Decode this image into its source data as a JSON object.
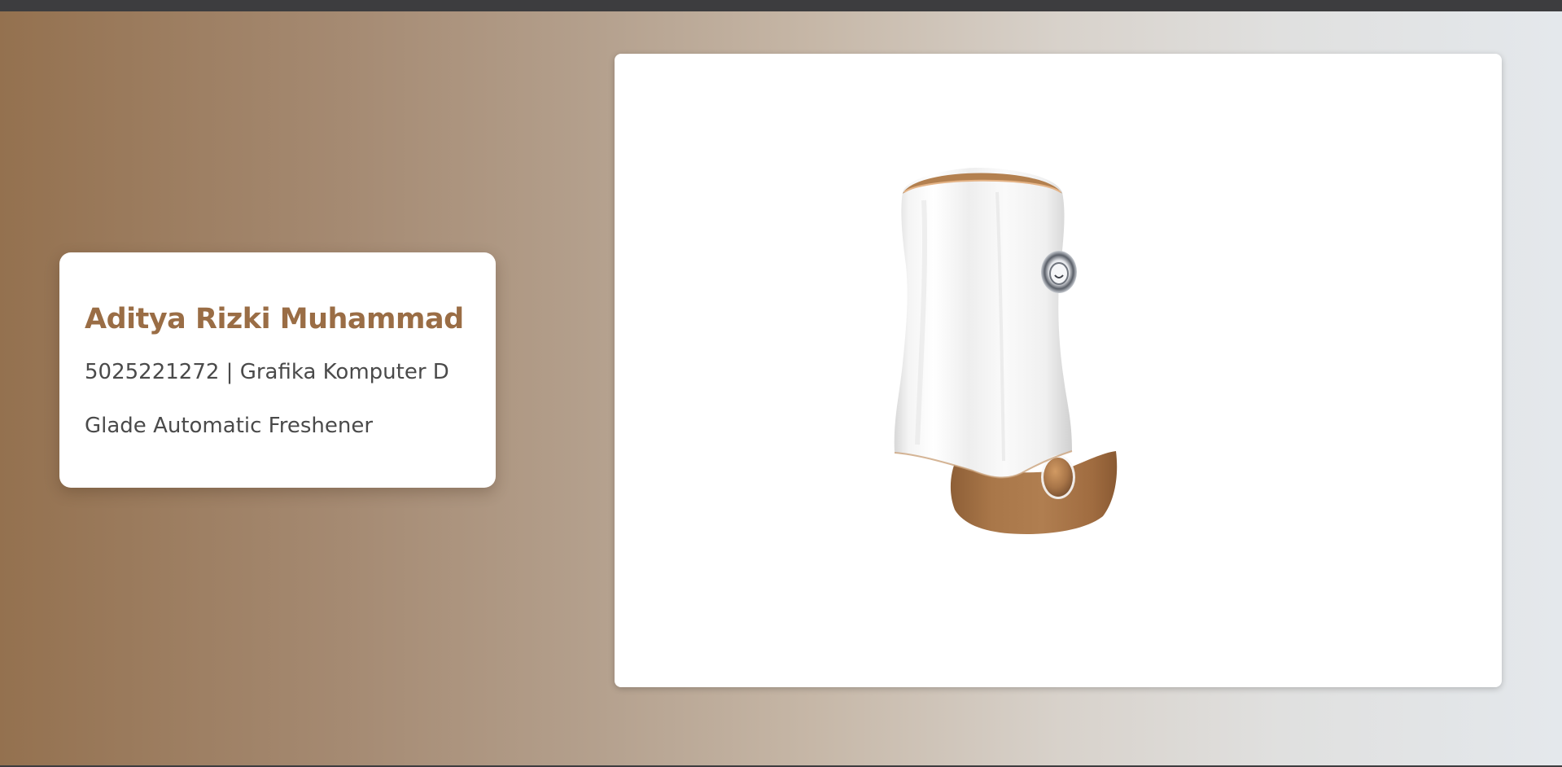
{
  "card": {
    "name": "Aditya Rizki Muhammad",
    "id_course": "5025221272 | Grafika Komputer D",
    "product": "Glade Automatic Freshener"
  },
  "model": {
    "object": "freshener-dispenser",
    "colors": {
      "body": "#f2f2f2",
      "base": "#a87548",
      "accent": "#9a6d45"
    }
  }
}
